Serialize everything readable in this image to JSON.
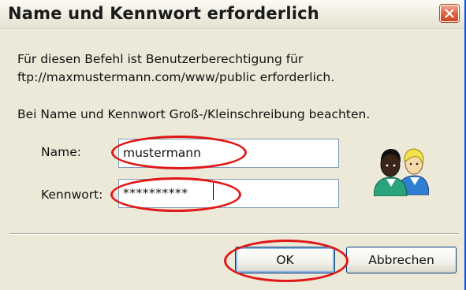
{
  "dialog": {
    "title": "Name und Kennwort erforderlich",
    "close_icon": "close-x-icon",
    "message_line1": "Für diesen Befehl ist Benutzerberechtigung für",
    "message_line2": "ftp://maxmustermann.com/www/public erforderlich.",
    "case_hint": "Bei Name und Kennwort Groß-/Kleinschreibung beachten.",
    "fields": {
      "name_label": "Name:",
      "name_value": "mustermann",
      "password_label": "Kennwort:",
      "password_value": "**********"
    },
    "icon": "users-icon",
    "buttons": {
      "ok": "OK",
      "cancel": "Abbrechen"
    }
  },
  "annotations": {
    "highlight_color": "#e01818"
  },
  "colors": {
    "dialog_bg": "#ece9d8",
    "close_button": "#e26845",
    "input_border": "#7f9db9",
    "button_border": "#003c74"
  }
}
